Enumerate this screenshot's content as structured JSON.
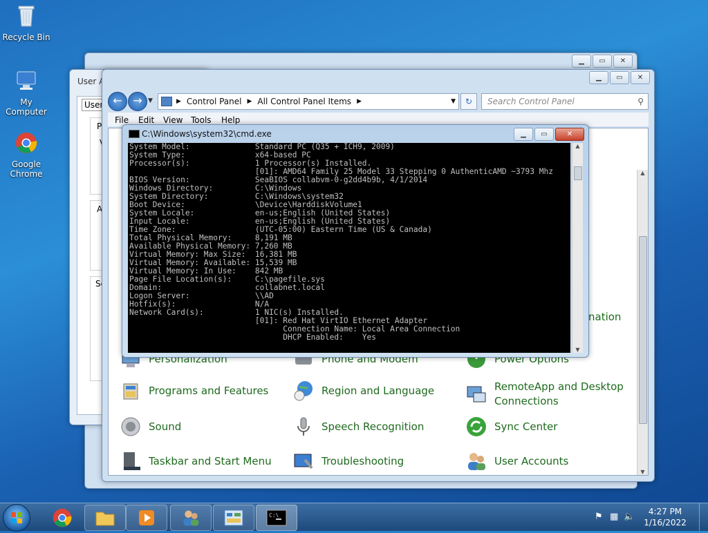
{
  "desktop": {
    "icons": [
      {
        "label": "Recycle Bin"
      },
      {
        "label": "My Computer"
      },
      {
        "label": "Google Chrome"
      }
    ]
  },
  "user_accounts_window": {
    "title_partial": "User A",
    "tab_partial": "Users",
    "fragments": [
      "P",
      "V",
      "A",
      "Se"
    ]
  },
  "control_panel": {
    "breadcrumb": [
      "Control Panel",
      "All Control Panel Items"
    ],
    "search_placeholder": "Search Control Panel",
    "menu": [
      "File",
      "Edit",
      "View",
      "Tools",
      "Help"
    ],
    "partial_text": "nation",
    "items": [
      {
        "label": "Personalization"
      },
      {
        "label": "Phone and Modem"
      },
      {
        "label": "Power Options"
      },
      {
        "label": "Programs and Features"
      },
      {
        "label": "Region and Language"
      },
      {
        "label": "RemoteApp and Desktop Connections"
      },
      {
        "label": "Sound"
      },
      {
        "label": "Speech Recognition"
      },
      {
        "label": "Sync Center"
      },
      {
        "label": "Taskbar and Start Menu"
      },
      {
        "label": "Troubleshooting"
      },
      {
        "label": "User Accounts"
      }
    ]
  },
  "cmd": {
    "title": "C:\\Windows\\system32\\cmd.exe",
    "lines": [
      "System Model:              Standard PC (Q35 + ICH9, 2009)",
      "System Type:               x64-based PC",
      "Processor(s):              1 Processor(s) Installed.",
      "                           [01]: AMD64 Family 25 Model 33 Stepping 0 AuthenticAMD ~3793 Mhz",
      "BIOS Version:              SeaBIOS collabvm-0-g2dd4b9b, 4/1/2014",
      "Windows Directory:         C:\\Windows",
      "System Directory:          C:\\Windows\\system32",
      "Boot Device:               \\Device\\HarddiskVolume1",
      "System Locale:             en-us;English (United States)",
      "Input Locale:              en-us;English (United States)",
      "Time Zone:                 (UTC-05:00) Eastern Time (US & Canada)",
      "Total Physical Memory:     8,191 MB",
      "Available Physical Memory: 7,260 MB",
      "Virtual Memory: Max Size:  16,381 MB",
      "Virtual Memory: Available: 15,539 MB",
      "Virtual Memory: In Use:    842 MB",
      "Page File Location(s):     C:\\pagefile.sys",
      "Domain:                    collabnet.local",
      "Logon Server:              \\\\AD",
      "Hotfix(s):                 N/A",
      "Network Card(s):           1 NIC(s) Installed.",
      "                           [01]: Red Hat VirtIO Ethernet Adapter",
      "                                 Connection Name: Local Area Connection",
      "                                 DHCP Enabled:    Yes"
    ]
  },
  "taskbar": {
    "time": "4:27 PM",
    "date": "1/16/2022"
  }
}
